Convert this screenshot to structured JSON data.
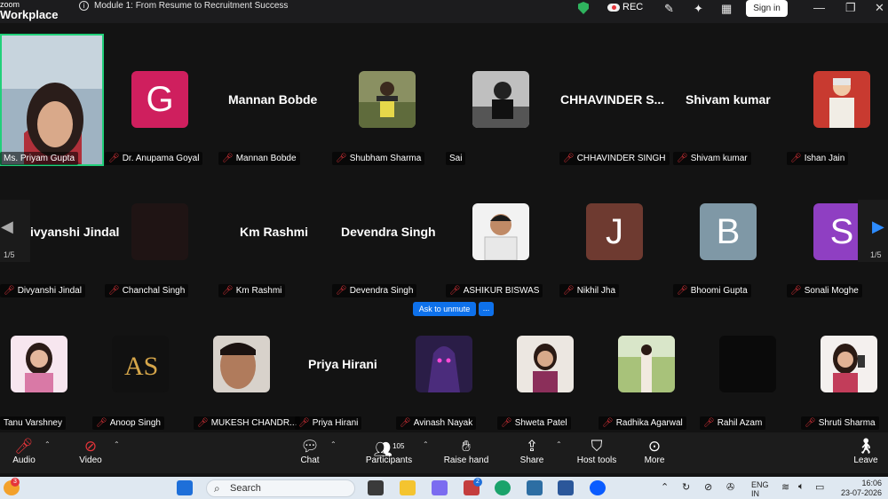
{
  "titlebar": {
    "brand_top": "zoom",
    "brand_bottom": "Workplace",
    "meeting_title": "Module 1: From Resume to Recruitment Success",
    "rec_label": "REC",
    "sign_in": "Sign in"
  },
  "gallery": {
    "page_indicator": "1/5",
    "page_indicator_right": "1/5",
    "rows": [
      [
        {
          "label": "Ms. Priyam Gupta",
          "type": "video"
        },
        {
          "label": "Dr. Anupama Goyal",
          "type": "avatar",
          "letter": "G",
          "color": "#cf1f5e"
        },
        {
          "label": "Mannan Bobde",
          "type": "name",
          "big": "Mannan Bobde"
        },
        {
          "label": "Shubham Sharma",
          "type": "photo",
          "photo": "man-outdoor"
        },
        {
          "label": "Sai",
          "type": "photo",
          "photo": "man-bw"
        },
        {
          "label": "CHHAVINDER SINGH",
          "type": "name",
          "big": "CHHAVINDER  S..."
        },
        {
          "label": "Shivam kumar",
          "type": "name",
          "big": "Shivam kumar"
        },
        {
          "label": "Ishan Jain",
          "type": "photo",
          "photo": "man-red"
        }
      ],
      [
        {
          "label": "Divyanshi Jindal",
          "type": "name",
          "big": "ivyanshi Jindal"
        },
        {
          "label": "Chanchal Singh",
          "type": "photo",
          "photo": "dark"
        },
        {
          "label": "Km Rashmi",
          "type": "name",
          "big": "Km Rashmi"
        },
        {
          "label": "Devendra Singh",
          "type": "name",
          "big": "Devendra Singh"
        },
        {
          "label": "ASHIKUR BISWAS",
          "type": "photo",
          "photo": "passport"
        },
        {
          "label": "Nikhil Jha",
          "type": "avatar",
          "letter": "J",
          "color": "#6e3a30"
        },
        {
          "label": "Bhoomi Gupta",
          "type": "avatar",
          "letter": "B",
          "color": "#7f98a6"
        },
        {
          "label": "Sonali Moghe",
          "type": "avatar",
          "letter": "S",
          "color": "#8f3fc2"
        }
      ],
      [
        {
          "label": "Tanu Varshney",
          "type": "photo",
          "photo": "woman-pink"
        },
        {
          "label": "Anoop Singh",
          "type": "photo",
          "photo": "logo-as"
        },
        {
          "label": "MUKESH CHANDR...",
          "type": "photo",
          "photo": "man-face"
        },
        {
          "label": "Priya Hirani",
          "type": "name",
          "big": "Priya Hirani"
        },
        {
          "label": "Avinash Nayak",
          "type": "photo",
          "photo": "game-char"
        },
        {
          "label": "Shweta Patel",
          "type": "photo",
          "photo": "woman-white"
        },
        {
          "label": "Radhika Agarwal",
          "type": "photo",
          "photo": "woman-field"
        },
        {
          "label": "Rahil Azam",
          "type": "photo",
          "photo": "dark"
        },
        {
          "label": "Shruti Sharma",
          "type": "photo",
          "photo": "woman-phone"
        }
      ]
    ],
    "ask_unmute": "Ask to unmute",
    "ask_more": "..."
  },
  "toolbar": {
    "audio": "Audio",
    "video": "Video",
    "chat": "Chat",
    "participants": "Participants",
    "participants_count": "105",
    "raise_hand": "Raise hand",
    "share": "Share",
    "host_tools": "Host tools",
    "more": "More",
    "leave": "Leave"
  },
  "taskbar": {
    "search_placeholder": "Search",
    "notification_count": "3",
    "teams_badge": "2",
    "lang_1": "ENG",
    "lang_2": "IN",
    "time": "16:06",
    "date": "23-07-2026"
  }
}
